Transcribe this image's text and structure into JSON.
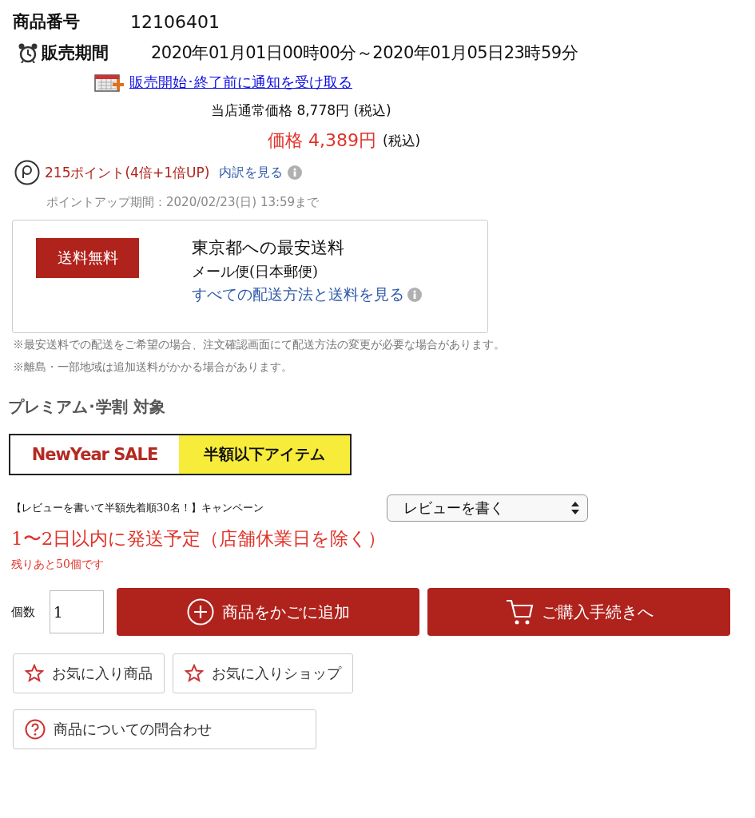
{
  "item_number": {
    "label": "商品番号",
    "value": "12106401"
  },
  "sale_period": {
    "label": "販売期間",
    "value": "2020年01月01日00時00分～2020年01月05日23時59分"
  },
  "notify_link": "販売開始･終了前に通知を受け取る",
  "regular_price": {
    "label": "当店通常価格",
    "amount": "8,778円",
    "tax": "(税込)"
  },
  "price": {
    "label": "価格",
    "amount": "4,389円",
    "tax": "(税込)"
  },
  "points": {
    "text": "215ポイント(4倍+1倍UP)",
    "link": "内訳を見る",
    "period": "ポイントアップ期間：2020/02/23(日) 13:59まで"
  },
  "shipping": {
    "badge": "送料無料",
    "title": "東京都への最安送料",
    "method": "メール便(日本郵便)",
    "link": "すべての配送方法と送料を見る"
  },
  "notes": [
    "※最安送料での配送をご希望の場合、注文確認画面にて配送方法の変更が必要な場合があります。",
    "※離島・一部地域は追加送料がかかる場合があります。"
  ],
  "premium_label": "プレミアム･学割 対象",
  "sale_banner": {
    "left": "NewYear SALE",
    "right": "半額以下アイテム"
  },
  "campaign": {
    "text": "【レビューを書いて半額先着順30名！】キャンペーン",
    "select": "レビューを書く"
  },
  "shipping_schedule": "1〜2日以内に発送予定（店舗休業日を除く）",
  "stock": "残りあと50個です",
  "quantity": {
    "label": "個数",
    "value": "1"
  },
  "buttons": [
    {
      "kind": "add",
      "label": "商品をかごに追加"
    },
    {
      "kind": "cart",
      "label": "ご購入手続きへ"
    }
  ],
  "favorites": [
    {
      "kind": "star",
      "label": "お気に入り商品"
    },
    {
      "kind": "star",
      "label": "お気に入りショップ"
    },
    {
      "kind": "question",
      "label": "商品についての問合わせ"
    }
  ]
}
